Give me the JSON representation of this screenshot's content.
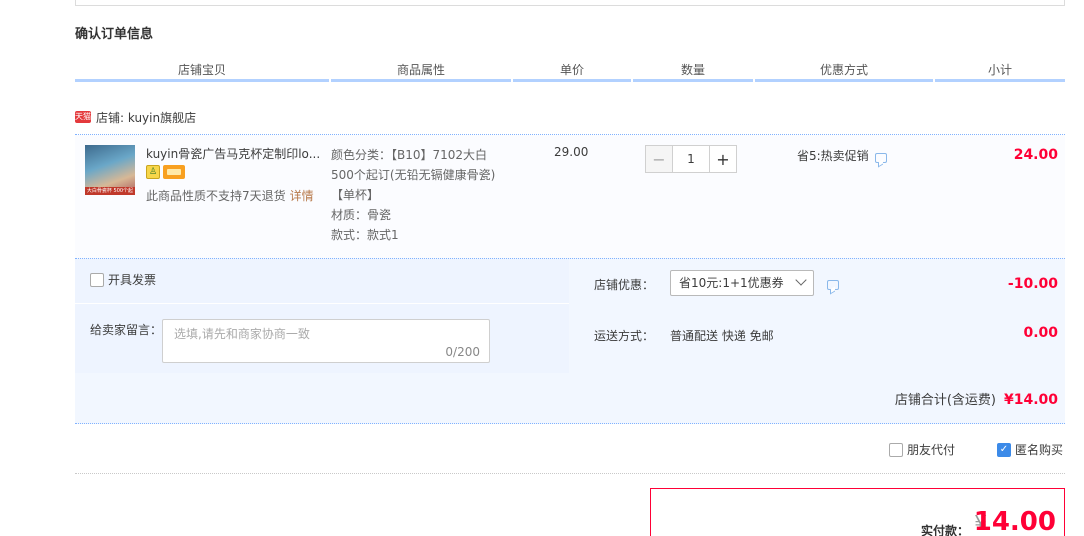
{
  "section_title": "确认订单信息",
  "headers": [
    "店铺宝贝",
    "商品属性",
    "单价",
    "数量",
    "优惠方式",
    "小计"
  ],
  "shop": {
    "badge": "天猫",
    "name": "店铺: kuyin旗舰店"
  },
  "item": {
    "thumb_caption": "大白骨瓷杯 500个起订",
    "title": "kuyin骨瓷广告马克杯定制印lo...",
    "no_return": "此商品性质不支持7天退货",
    "detail_link": "详情",
    "attr_color": "颜色分类：【B10】7102大白 500个起订(无铅无镉健康骨瓷)【单杯】",
    "attr_material": "材质：骨瓷",
    "attr_style": "款式：款式1",
    "price": "29.00",
    "quantity": "1",
    "promotion": "省5:热卖促销",
    "subtotal": "24.00"
  },
  "invoice_label": "开具发票",
  "message": {
    "label": "给卖家留言：",
    "placeholder": "选填,请先和商家协商一致",
    "counter": "0/200"
  },
  "shop_discount": {
    "label": "店铺优惠：",
    "selected": "省10元:1+1优惠券",
    "amount": "-10.00"
  },
  "shipping": {
    "label": "运送方式：",
    "method": "普通配送 快递 免邮",
    "amount": "0.00"
  },
  "shop_total": {
    "label": "店铺合计(含运费)",
    "value": "¥14.00"
  },
  "options": {
    "friend_pay": "朋友代付",
    "anonymous": "匿名购买"
  },
  "payment": {
    "label": "实付款：",
    "currency": "¥",
    "amount": "14.00"
  },
  "colors": {
    "accent_red": "#ff0036",
    "header_border": "#b2d1ff",
    "panel_bg": "#f2f7ff"
  }
}
